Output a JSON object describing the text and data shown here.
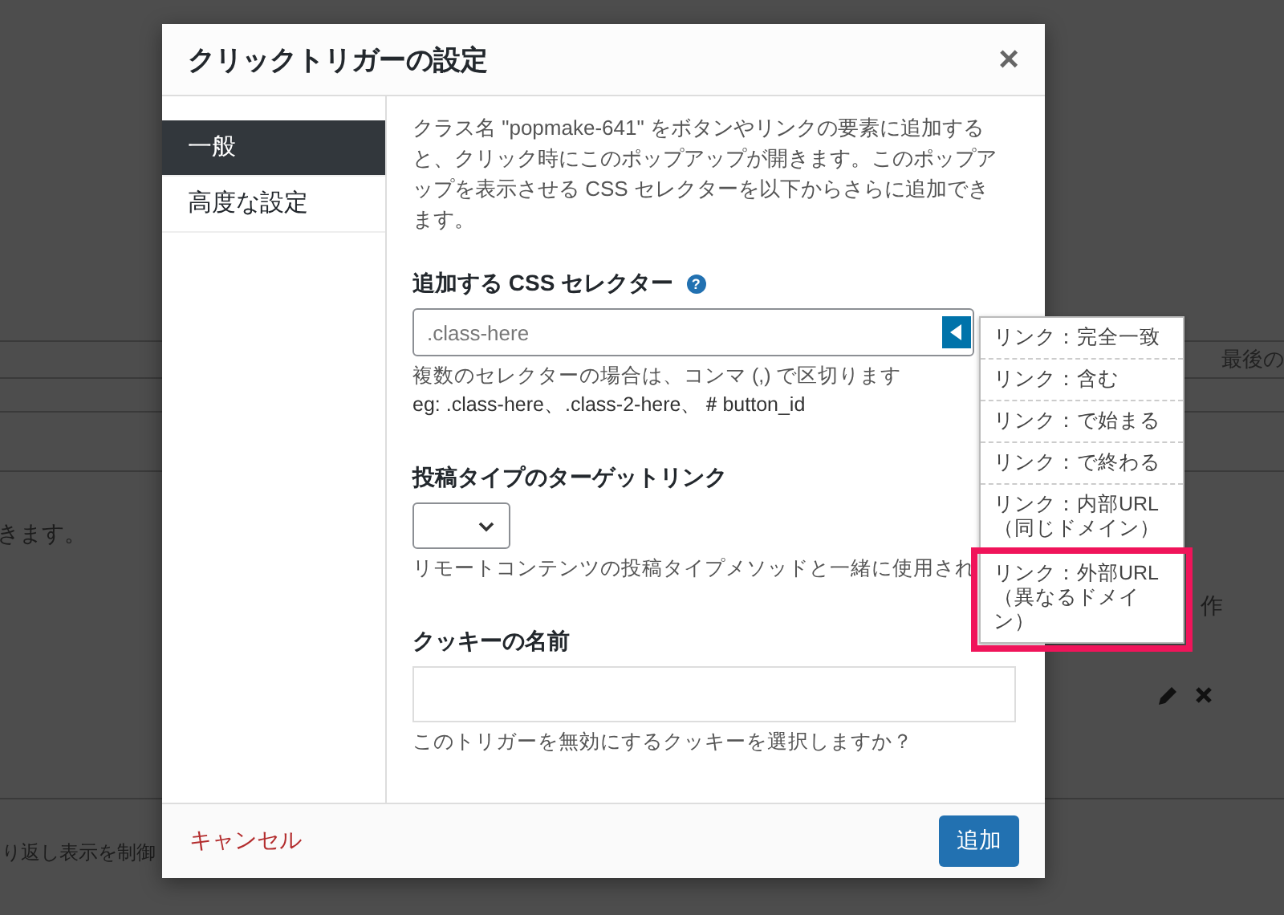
{
  "background": {
    "column_heading": "最後の",
    "text_1": "きます。",
    "text_2": "作",
    "text_3": "り返し表示を制御"
  },
  "dialog": {
    "title": "クリックトリガーの設定",
    "close": "×",
    "tabs": [
      {
        "label": "一般",
        "selected": true
      },
      {
        "label": "高度な設定",
        "selected": false
      }
    ],
    "intro": "クラス名 \"popmake-641\" をボタンやリンクの要素に追加すると、クリック時にこのポップアップが開きます。このポップアップを表示させる CSS セレクターを以下からさらに追加できます。",
    "selector": {
      "label": "追加する CSS セレクター",
      "help": "?",
      "placeholder": ".class-here",
      "hint": "複数のセレクターの場合は、コンマ (,) で区切ります",
      "example": "eg: .class-here、.class-2-here、＃button_id",
      "options": [
        {
          "label": "リンク：完全一致",
          "highlighted": false
        },
        {
          "label": "リンク：含む",
          "highlighted": false
        },
        {
          "label": "リンク：で始まる",
          "highlighted": false
        },
        {
          "label": "リンク：で終わる",
          "highlighted": false
        },
        {
          "label": "リンク：内部URL（同じドメイン）",
          "highlighted": false
        },
        {
          "label": "リンク：外部URL（異なるドメイン）",
          "highlighted": true
        }
      ]
    },
    "post_type": {
      "label": "投稿タイプのターゲットリンク",
      "hint": "リモートコンテンツの投稿タイプメソッドと一緒に使用され"
    },
    "cookie": {
      "label": "クッキーの名前",
      "hint": "このトリガーを無効にするクッキーを選択しますか？"
    },
    "cancel": "キャンセル",
    "submit": "追加"
  }
}
